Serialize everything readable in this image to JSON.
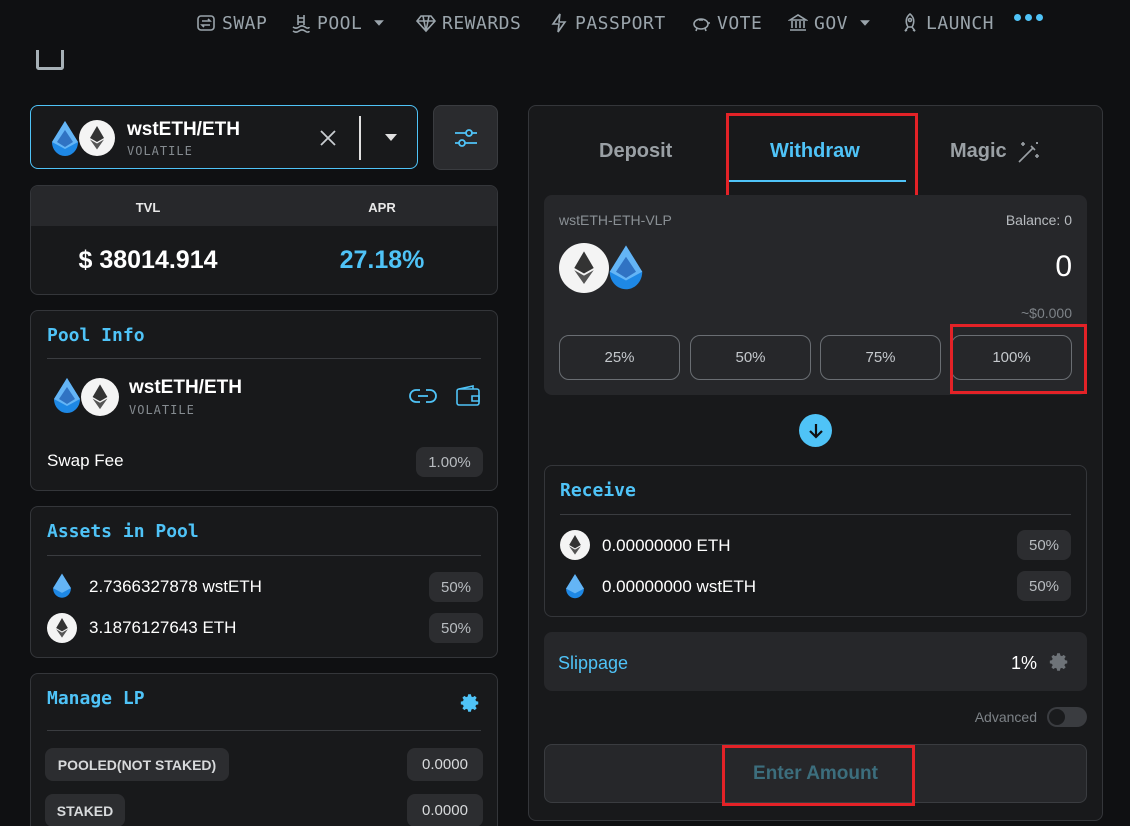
{
  "nav": {
    "items": [
      {
        "label": "SWAP",
        "icon": "swap-icon"
      },
      {
        "label": "POOL",
        "icon": "pool-icon",
        "dropdown": true
      },
      {
        "label": "REWARDS",
        "icon": "diamond-icon"
      },
      {
        "label": "PASSPORT",
        "icon": "bolt-icon"
      },
      {
        "label": "VOTE",
        "icon": "piggy-icon"
      },
      {
        "label": "GOV",
        "icon": "bank-icon",
        "dropdown": true
      },
      {
        "label": "LAUNCH",
        "icon": "rocket-icon"
      }
    ]
  },
  "pair_select": {
    "name": "wstETH/ETH",
    "type": "VOLATILE"
  },
  "stats": {
    "tvl_label": "TVL",
    "apr_label": "APR",
    "tvl_value": "$ 38014.914",
    "apr_value": "27.18%"
  },
  "pool_info": {
    "title": "Pool Info",
    "name": "wstETH/ETH",
    "type": "VOLATILE",
    "swap_fee_label": "Swap Fee",
    "swap_fee_value": "1.00%"
  },
  "assets": {
    "title": "Assets in Pool",
    "rows": [
      {
        "amount": "2.7366327878 wstETH",
        "share": "50%"
      },
      {
        "amount": "3.1876127643 ETH",
        "share": "50%"
      }
    ]
  },
  "manage_lp": {
    "title": "Manage LP",
    "rows": [
      {
        "label": "POOLED(NOT STAKED)",
        "value": "0.0000"
      },
      {
        "label": "STAKED",
        "value": "0.0000"
      }
    ]
  },
  "tabs": {
    "deposit": "Deposit",
    "withdraw": "Withdraw",
    "magic": "Magic"
  },
  "withdraw": {
    "token_label": "wstETH-ETH-VLP",
    "balance": "Balance: 0",
    "amount": "0",
    "usd": "~$0.000",
    "percents": [
      "25%",
      "50%",
      "75%",
      "100%"
    ]
  },
  "receive": {
    "title": "Receive",
    "rows": [
      {
        "amount": "0.00000000 ETH",
        "share": "50%"
      },
      {
        "amount": "0.00000000 wstETH",
        "share": "50%"
      }
    ]
  },
  "slippage": {
    "label": "Slippage",
    "value": "1%"
  },
  "advanced_label": "Advanced",
  "submit_label": "Enter Amount",
  "colors": {
    "accent": "#4fc3f7",
    "highlight": "#e32227",
    "background": "#0f1012",
    "panel": "#18191b"
  }
}
